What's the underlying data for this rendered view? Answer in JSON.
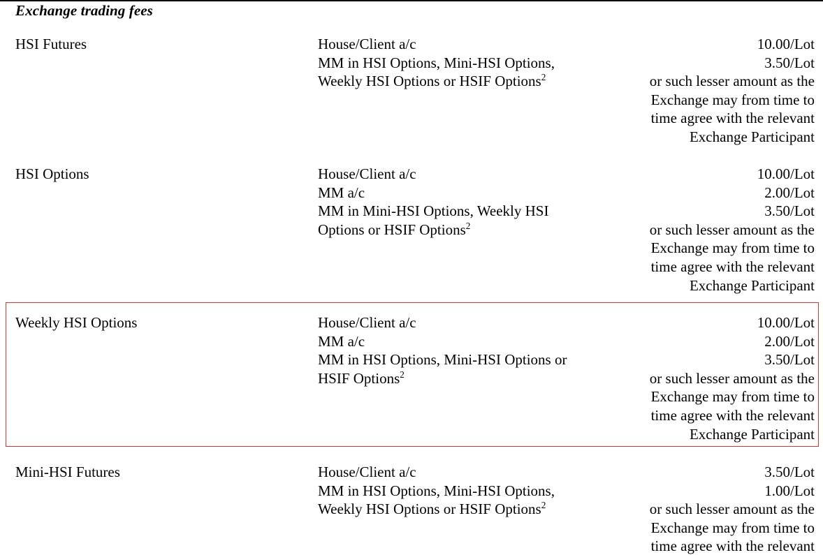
{
  "document": {
    "heading": "Exchange trading fees",
    "footnote_marker": "2",
    "rule_color": "#000000",
    "highlight_border_color": "#CD3A33",
    "text_color": "#000000"
  },
  "rows": [
    {
      "product": "HSI Futures",
      "highlighted": false,
      "basis_lines": [
        "House/Client a/c",
        "MM in HSI Options, Mini-HSI Options, Weekly HSI Options or HSIF Options"
      ],
      "rate_lines": [
        "10.00/Lot",
        "3.50/Lot",
        "or such lesser amount as the Exchange may from time to time agree with the relevant Exchange Participant"
      ]
    },
    {
      "product": "HSI Options",
      "highlighted": false,
      "basis_lines": [
        "House/Client a/c",
        "MM a/c",
        "MM in Mini-HSI Options, Weekly HSI Options or HSIF Options"
      ],
      "rate_lines": [
        "10.00/Lot",
        "2.00/Lot",
        "3.50/Lot",
        "or such lesser amount as the Exchange may from time to time agree with the relevant Exchange Participant"
      ]
    },
    {
      "product": "Weekly HSI Options",
      "highlighted": true,
      "basis_lines": [
        "House/Client a/c",
        "MM a/c",
        "MM in HSI Options, Mini-HSI Options or HSIF Options"
      ],
      "rate_lines": [
        "10.00/Lot",
        "2.00/Lot",
        "3.50/Lot",
        "or such lesser amount as the Exchange may from time to time agree with the relevant Exchange Participant"
      ]
    },
    {
      "product": "Mini-HSI Futures",
      "highlighted": false,
      "basis_lines": [
        "House/Client a/c",
        "MM in HSI Options, Mini-HSI Options, Weekly HSI Options or HSIF Options"
      ],
      "rate_lines": [
        "3.50/Lot",
        "1.00/Lot",
        "or such lesser amount as the Exchange may from time to time agree with the relevant Exchange Participant"
      ]
    }
  ],
  "row_text": {
    "r0": {
      "product": "HSI Futures",
      "b0": "House/Client a/c",
      "b1a": "MM in HSI Options, Mini-HSI Options,",
      "b1b": "Weekly HSI Options or HSIF Options",
      "r0v": "10.00/Lot",
      "r1v": "3.50/Lot",
      "r2a": "or such lesser amount as the",
      "r2b": "Exchange may from time to",
      "r2c": "time agree with the relevant",
      "r2d": "Exchange Participant"
    },
    "r1": {
      "product": "HSI Options",
      "b0": "House/Client a/c",
      "b1": "MM a/c",
      "b2a": "MM in Mini-HSI Options, Weekly HSI",
      "b2b": "Options or HSIF Options",
      "r0v": "10.00/Lot",
      "r1v": "2.00/Lot",
      "r2v": "3.50/Lot",
      "r3a": "or such lesser amount as the",
      "r3b": "Exchange may from time to",
      "r3c": "time agree with the relevant",
      "r3d": "Exchange Participant"
    },
    "r2": {
      "product": "Weekly HSI Options",
      "b0": "House/Client a/c",
      "b1": "MM a/c",
      "b2a": "MM in HSI Options, Mini-HSI Options or",
      "b2b": "HSIF Options",
      "r0v": "10.00/Lot",
      "r1v": "2.00/Lot",
      "r2v": "3.50/Lot",
      "r3a": "or such lesser amount as the",
      "r3b": "Exchange may from time to",
      "r3c": "time agree with the relevant",
      "r3d": "Exchange Participant"
    },
    "r3": {
      "product": "Mini-HSI Futures",
      "b0": "House/Client a/c",
      "b1a": "MM in HSI Options, Mini-HSI Options,",
      "b1b": "Weekly HSI Options or HSIF Options",
      "r0v": "3.50/Lot",
      "r1v": "1.00/Lot",
      "r2a": "or such lesser amount as the",
      "r2b": "Exchange may from time to",
      "r2c": "time agree with the relevant"
    }
  }
}
